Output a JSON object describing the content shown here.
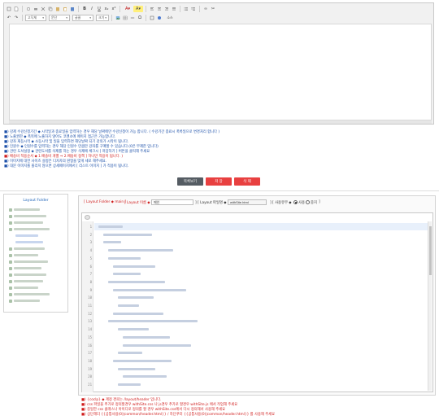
{
  "editor": {
    "font_select": "고딕체",
    "format_select": "문단",
    "size_select": "글꼴",
    "size2_select": "크기",
    "source_label": "소스",
    "toolbar_icons": [
      "source-icon",
      "new-page-icon",
      "preview-icon",
      "print-icon",
      "cut-icon",
      "copy-icon",
      "paste-icon",
      "paste-text-icon",
      "paste-word-icon",
      "bold-icon",
      "italic-icon",
      "underline-icon",
      "subscript-icon",
      "superscript-icon",
      "text-color-icon",
      "bg-color-icon",
      "align-left-icon",
      "align-center-icon",
      "align-right-icon",
      "align-justify-icon",
      "numbered-list-icon",
      "bulleted-list-icon",
      "link-icon",
      "unlink-icon"
    ]
  },
  "notes": [
    {
      "text": "■) 강제 수강신청기간 ◆ 시작일과 종료일을 입력하는 경우 해당 날짜에만 수강신청이 가능 합니다. ( 수강기간 종료시 폭록일으로 변경처리 합니다 )",
      "color": "blue"
    },
    {
      "text": "■) 노출권한 ◆ 폭목에 노출하지 않아도 코멘소에 페이지 접근은 가능합니다.",
      "color": "blue"
    },
    {
      "text": "■) 강좌 재등시작 ◆ 소등시작 및 일을 입력하면 해당날짜 되기 강의가 시작이 됩니다.",
      "color": "blue"
    },
    {
      "text": "■) 인원수 ◆ 인원수를 입력하는 경우 해당 인원수 만큼만 강좌를 구매할 수 있습니다.(0은 무제한 입니다)",
      "color": "blue"
    },
    {
      "text": "■) 관련 도서설정 ◆ 관련도서를 삭제를 하는 경우 삭제에 체크시 [ 저장하기 ] 버튼을 클릭해 주세요",
      "color": "blue"
    },
    {
      "text": "■) 배송비 적용순서 ◆ 1.배송비 개별 ⇒ 2.배송비 정책 ] 하나만 적용이 됩니다. )",
      "color": "red"
    },
    {
      "text": "■) 이미지에 대한 사이즈 설정은 디자자의 원형을 맞게 세로 해주세요.",
      "color": "blue"
    },
    {
      "text": "■) 대문 이미지를 올리지 않으면 상세페이지에서 [ 리스트 이미지 ] 가 적용이 됩니다.",
      "color": "blue"
    }
  ],
  "buttons": {
    "list": "목록보기",
    "save": "저 장",
    "delete": "삭 제"
  },
  "folder": {
    "title": "Layout Folder"
  },
  "layout_header": {
    "path": "[ Layout Folder ◆ main ]",
    "name_label": "[ Layout 이름 ◆",
    "name_value": "메인",
    "file_label": "] [ Layout 파일명 ◆",
    "file_value": "withSite.html",
    "use_label": "] [ 사용유무 ◆",
    "use_yes": "사용",
    "use_no": "중지",
    "use_end": "]",
    "use_selected": "사용"
  },
  "code": {
    "line_numbers": [
      "1",
      "2",
      "3",
      "4",
      "5",
      "6",
      "7",
      "8",
      "9",
      "10",
      "11",
      "12",
      "13",
      "14",
      "15",
      "16",
      "17",
      "18",
      "19",
      "20",
      "21"
    ]
  },
  "footer_notes": [
    "■) {coclp} ◆ 계정 경로는 /layout/header 입니다.",
    "■) css 파일을 추가로 정의할경우 withSite.css 나 js경우 추가로 할경우 withSite.js 에서 작업해 주세요",
    "■) 중일한 css 클래스나 아이디로 정의를 할 경우 withSite.css에서 다시 정의해서 사용해 주세요",
    "■) 상단헤더 {{공통사용(0)|common/header.html}} / 하단푸터 {{공통사용(0)|common/header.html}} 를 사용해 주세요"
  ],
  "colors": {
    "note_blue": "#1a4ea8",
    "note_red": "#d01c1c",
    "btn_list": "#555c63",
    "btn_save": "#e84040",
    "btn_delete": "#e84040",
    "folder_title": "#1e63b8"
  }
}
